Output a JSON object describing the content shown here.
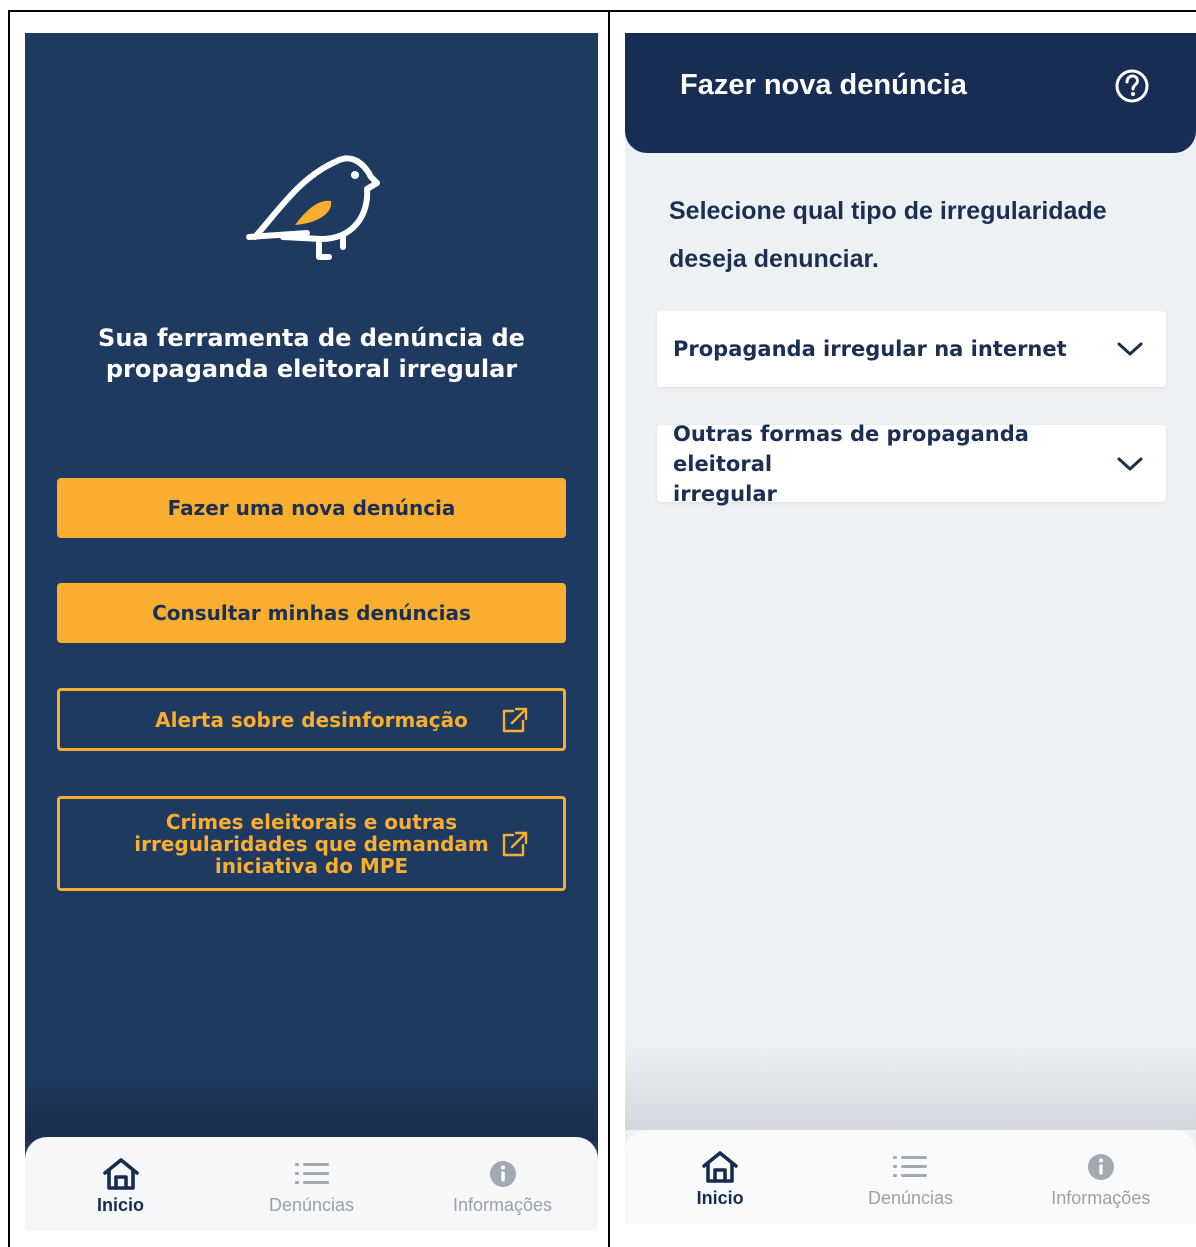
{
  "left": {
    "tagline_line1": "Sua ferramenta de denúncia de",
    "tagline_line2": "propaganda eleitoral irregular",
    "buttons": {
      "new_report": "Fazer uma nova denúncia",
      "my_reports": "Consultar minhas denúncias",
      "misinfo_alert": "Alerta sobre desinformação",
      "crimes_line1": "Crimes eleitorais e outras",
      "crimes_line2": "irregularidades que demandam",
      "crimes_line3": "iniciativa do MPE"
    }
  },
  "right": {
    "header_title": "Fazer nova denúncia",
    "instruction_line1": "Selecione qual tipo de irregularidade",
    "instruction_line2": "deseja denunciar.",
    "options": [
      {
        "label": "Propaganda irregular na internet"
      },
      {
        "label_line1": "Outras formas de propaganda eleitoral",
        "label_line2": "irregular"
      }
    ]
  },
  "nav": {
    "home": "Inicio",
    "reports": "Denúncias",
    "info": "Informações"
  },
  "colors": {
    "navy": "#1f3a60",
    "header_navy": "#172d53",
    "accent": "#f9ae2f",
    "text_dark": "#1b2f52",
    "nav_inactive": "#9aa1ab"
  },
  "icons": [
    "bird-logo-icon",
    "external-link-icon",
    "home-icon",
    "list-icon",
    "info-icon",
    "help-icon",
    "chevron-down-icon"
  ]
}
